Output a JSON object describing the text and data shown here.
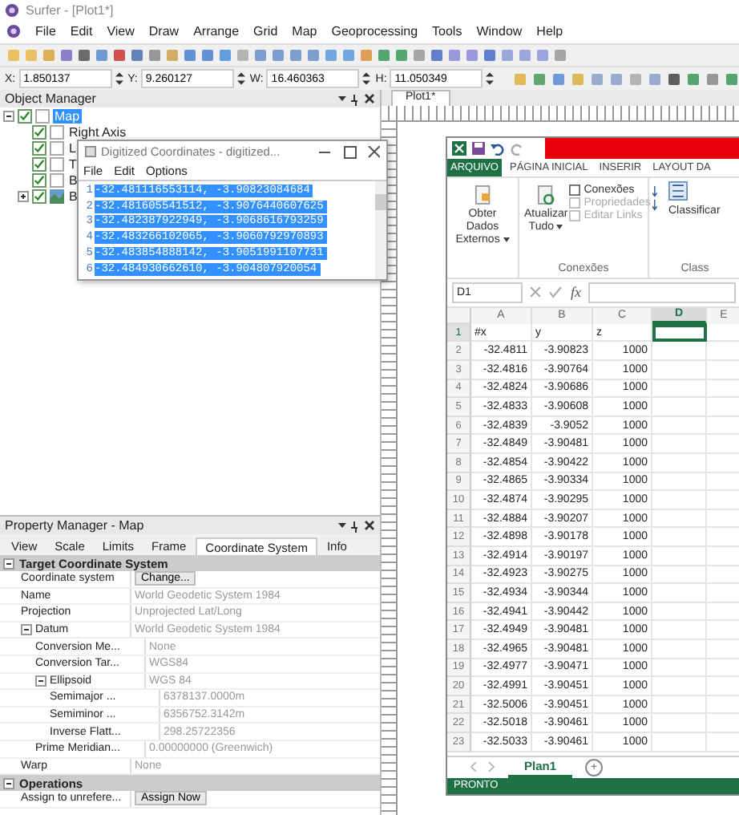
{
  "window": {
    "title": "Surfer - [Plot1*]"
  },
  "menu": [
    "File",
    "Edit",
    "View",
    "Draw",
    "Arrange",
    "Grid",
    "Map",
    "Geoprocessing",
    "Tools",
    "Window",
    "Help"
  ],
  "coord_fields": [
    {
      "label": "X:",
      "value": "1.850137"
    },
    {
      "label": "Y:",
      "value": "9.260127"
    },
    {
      "label": "W:",
      "value": "16.460363"
    },
    {
      "label": "H:",
      "value": "11.050349"
    }
  ],
  "object_manager": {
    "title": "Object Manager",
    "tree": [
      {
        "label": "Map",
        "checked": true,
        "selected": true,
        "expanded": true,
        "children": [
          {
            "label": "Right Axis",
            "checked": true,
            "kind": "axis"
          },
          {
            "label": "L",
            "checked": true,
            "kind": "axis"
          },
          {
            "label": "T",
            "checked": true,
            "kind": "axis"
          },
          {
            "label": "B",
            "checked": true,
            "kind": "axis"
          },
          {
            "label": "B",
            "checked": true,
            "kind": "layer",
            "expanded": false
          }
        ]
      }
    ]
  },
  "digitized_window": {
    "title": "Digitized Coordinates - digitized...",
    "menu": [
      "File",
      "Edit",
      "Options"
    ],
    "lines": [
      {
        "num": "1",
        "text": "-32.481116553114, -3.90823084684"
      },
      {
        "num": "2",
        "text": "-32.481605541512, -3.9076440607625"
      },
      {
        "num": "3",
        "text": "-32.482387922949, -3.9068616793259"
      },
      {
        "num": "4",
        "text": "-32.483266102065, -3.9060792970893"
      },
      {
        "num": "5",
        "text": "-32.483854888142, -3.9051991107731"
      },
      {
        "num": "6",
        "text": "-32.484930662610, -3.904807920054"
      }
    ]
  },
  "property_manager": {
    "title": "Property Manager - Map",
    "tabs": [
      {
        "label": "View",
        "selected": false
      },
      {
        "label": "Scale",
        "selected": false
      },
      {
        "label": "Limits",
        "selected": false
      },
      {
        "label": "Frame",
        "selected": false
      },
      {
        "label": "Coordinate System",
        "selected": true
      },
      {
        "label": "Info",
        "selected": false
      }
    ],
    "sections": [
      {
        "label": "Target Coordinate System",
        "expanded": true,
        "rows": [
          {
            "label": "Coordinate system",
            "value": "Change...",
            "kind": "button"
          },
          {
            "label": "Name",
            "value": "World Geodetic System 1984",
            "kind": "text"
          },
          {
            "label": "Projection",
            "value": "Unprojected Lat/Long",
            "kind": "text"
          },
          {
            "label": "Datum",
            "value": "World Geodetic System 1984",
            "kind": "text",
            "expanded": true,
            "children": [
              {
                "label": "Conversion Me...",
                "value": "None",
                "kind": "text"
              },
              {
                "label": "Conversion Tar...",
                "value": "WGS84",
                "kind": "text"
              },
              {
                "label": "Ellipsoid",
                "value": "WGS 84",
                "kind": "text",
                "expanded": true,
                "children": [
                  {
                    "label": "Semimajor ...",
                    "value": "6378137.0000m",
                    "kind": "text"
                  },
                  {
                    "label": "Semiminor ...",
                    "value": "6356752.3142m",
                    "kind": "text"
                  },
                  {
                    "label": "Inverse Flatt...",
                    "value": "298.25722356",
                    "kind": "text"
                  }
                ]
              },
              {
                "label": "Prime Meridian...",
                "value": "0.00000000 (Greenwich)",
                "kind": "text"
              }
            ]
          },
          {
            "label": "Warp",
            "value": "None",
            "kind": "text"
          }
        ]
      },
      {
        "label": "Operations",
        "expanded": true,
        "rows": [
          {
            "label": "Assign to unrefere...",
            "value": "Assign Now",
            "kind": "button"
          }
        ]
      }
    ]
  },
  "plot_tab": {
    "label": "Plot1*"
  },
  "excel": {
    "tabs": [
      {
        "label": "ARQUIVO",
        "selected": true
      },
      {
        "label": "PÁGINA INICIAL",
        "selected": false
      },
      {
        "label": "INSERIR",
        "selected": false
      },
      {
        "label": "LAYOUT DA",
        "selected": false
      }
    ],
    "get_data": {
      "label": "Obter Dados Externos"
    },
    "refresh": {
      "label": "Atualizar Tudo"
    },
    "connection_items": [
      {
        "label": "Conexões",
        "disabled": false
      },
      {
        "label": "Propriedades",
        "disabled": true
      },
      {
        "label": "Editar Links",
        "disabled": true
      }
    ],
    "connections_group": "Conexões",
    "sort": {
      "label": "Classificar"
    },
    "sort_group": "Class",
    "name_box": "D1",
    "fx": "fx",
    "columns": [
      {
        "label": "A",
        "selected": false
      },
      {
        "label": "B",
        "selected": false
      },
      {
        "label": "C",
        "selected": false
      },
      {
        "label": "D",
        "selected": true
      },
      {
        "label": "E",
        "selected": false
      }
    ],
    "rows": [
      {
        "num": "1",
        "selected": true,
        "kind": "text",
        "cells": [
          "#x",
          "y",
          "z"
        ]
      },
      {
        "num": "2",
        "selected": false,
        "kind": "number",
        "cells": [
          "-32.4811",
          "-3.90823",
          "1000"
        ]
      },
      {
        "num": "3",
        "selected": false,
        "kind": "number",
        "cells": [
          "-32.4816",
          "-3.90764",
          "1000"
        ]
      },
      {
        "num": "4",
        "selected": false,
        "kind": "number",
        "cells": [
          "-32.4824",
          "-3.90686",
          "1000"
        ]
      },
      {
        "num": "5",
        "selected": false,
        "kind": "number",
        "cells": [
          "-32.4833",
          "-3.90608",
          "1000"
        ]
      },
      {
        "num": "6",
        "selected": false,
        "kind": "number",
        "cells": [
          "-32.4839",
          "-3.9052",
          "1000"
        ]
      },
      {
        "num": "7",
        "selected": false,
        "kind": "number",
        "cells": [
          "-32.4849",
          "-3.90481",
          "1000"
        ]
      },
      {
        "num": "8",
        "selected": false,
        "kind": "number",
        "cells": [
          "-32.4854",
          "-3.90422",
          "1000"
        ]
      },
      {
        "num": "9",
        "selected": false,
        "kind": "number",
        "cells": [
          "-32.4865",
          "-3.90334",
          "1000"
        ]
      },
      {
        "num": "10",
        "selected": false,
        "kind": "number",
        "cells": [
          "-32.4874",
          "-3.90295",
          "1000"
        ]
      },
      {
        "num": "11",
        "selected": false,
        "kind": "number",
        "cells": [
          "-32.4884",
          "-3.90207",
          "1000"
        ]
      },
      {
        "num": "12",
        "selected": false,
        "kind": "number",
        "cells": [
          "-32.4898",
          "-3.90178",
          "1000"
        ]
      },
      {
        "num": "13",
        "selected": false,
        "kind": "number",
        "cells": [
          "-32.4914",
          "-3.90197",
          "1000"
        ]
      },
      {
        "num": "14",
        "selected": false,
        "kind": "number",
        "cells": [
          "-32.4923",
          "-3.90275",
          "1000"
        ]
      },
      {
        "num": "15",
        "selected": false,
        "kind": "number",
        "cells": [
          "-32.4934",
          "-3.90344",
          "1000"
        ]
      },
      {
        "num": "16",
        "selected": false,
        "kind": "number",
        "cells": [
          "-32.4941",
          "-3.90442",
          "1000"
        ]
      },
      {
        "num": "17",
        "selected": false,
        "kind": "number",
        "cells": [
          "-32.4949",
          "-3.90481",
          "1000"
        ]
      },
      {
        "num": "18",
        "selected": false,
        "kind": "number",
        "cells": [
          "-32.4965",
          "-3.90481",
          "1000"
        ]
      },
      {
        "num": "19",
        "selected": false,
        "kind": "number",
        "cells": [
          "-32.4977",
          "-3.90471",
          "1000"
        ]
      },
      {
        "num": "20",
        "selected": false,
        "kind": "number",
        "cells": [
          "-32.4991",
          "-3.90451",
          "1000"
        ]
      },
      {
        "num": "21",
        "selected": false,
        "kind": "number",
        "cells": [
          "-32.5006",
          "-3.90451",
          "1000"
        ]
      },
      {
        "num": "22",
        "selected": false,
        "kind": "number",
        "cells": [
          "-32.5018",
          "-3.90461",
          "1000"
        ]
      },
      {
        "num": "23",
        "selected": false,
        "kind": "number",
        "cells": [
          "-32.5033",
          "-3.90461",
          "1000"
        ]
      }
    ],
    "sheet_tabs": [
      {
        "label": "Plan1",
        "selected": true
      }
    ],
    "add_sheet": "+",
    "status": "PRONTO"
  }
}
